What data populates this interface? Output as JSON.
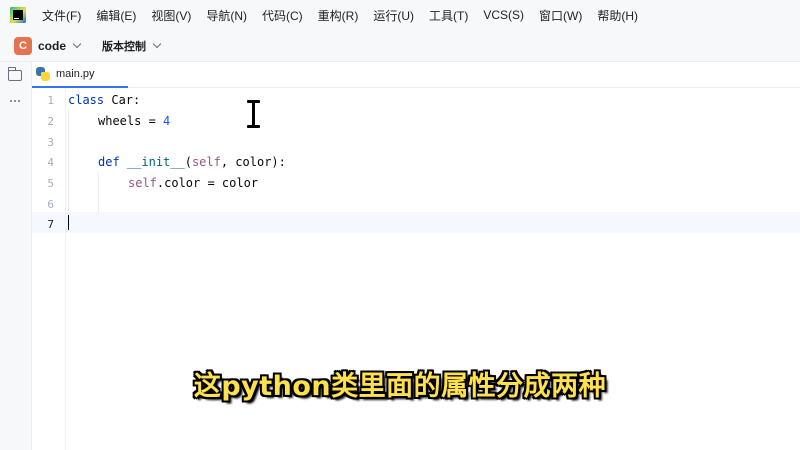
{
  "menu": [
    "文件(F)",
    "编辑(E)",
    "视图(V)",
    "导航(N)",
    "代码(C)",
    "重构(R)",
    "运行(U)",
    "工具(T)",
    "VCS(S)",
    "窗口(W)",
    "帮助(H)"
  ],
  "project": {
    "badge": "C",
    "name": "code",
    "vcs_label": "版本控制",
    "badge_color": "#e5734f"
  },
  "tab": {
    "label": "main.py",
    "active_underline": "#3574f0"
  },
  "editor": {
    "line_numbers": [
      "1",
      "2",
      "3",
      "4",
      "5",
      "6",
      "7"
    ],
    "current_line": 7,
    "code": {
      "l1_kw": "class",
      "l1_rest": " Car:",
      "l2": "wheels = ",
      "l2_num": "4",
      "l4_kw": "def",
      "l4_fn": "__init__",
      "l4_open": "(",
      "l4_self": "self",
      "l4_rest": ", color):",
      "l5_self": "self",
      "l5_rest": ".color = color"
    }
  },
  "subtitle": "这python类里面的属性分成两种",
  "colors": {
    "keyword": "#0033b3",
    "function": "#00627a",
    "number": "#1750eb",
    "self": "#94558d",
    "subtitle": "#ffe14d"
  }
}
